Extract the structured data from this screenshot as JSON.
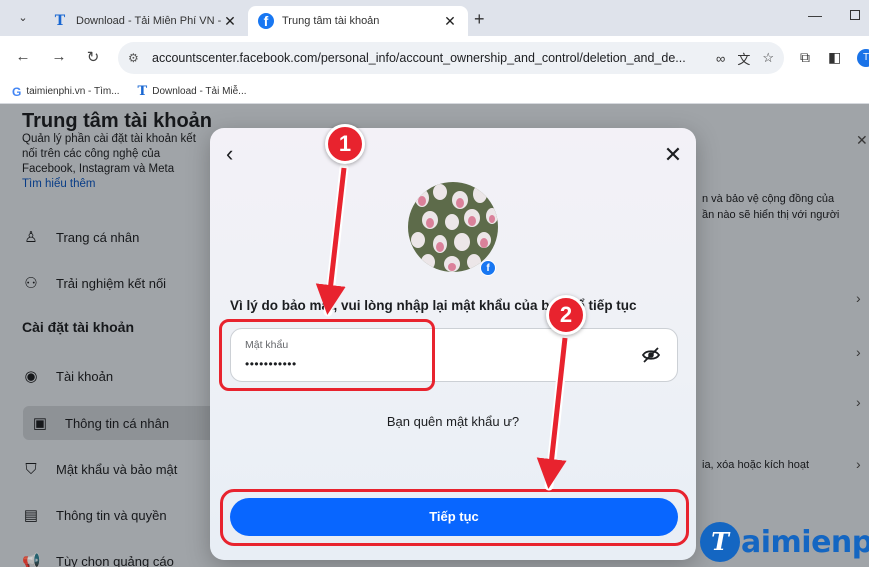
{
  "browser": {
    "tabs": [
      {
        "title": "Download - Tải Miễn Phí VN - P",
        "active": false,
        "icon": "taimienphi-favicon"
      },
      {
        "title": "Trung tâm tài khoản",
        "active": true,
        "icon": "facebook-favicon"
      }
    ],
    "url": "accountscenter.facebook.com/personal_info/account_ownership_and_control/deletion_and_de...",
    "bookmarks": [
      {
        "label": "taimienphi.vn - Tìm...",
        "icon": "google-favicon"
      },
      {
        "label": "Download - Tải Miễ...",
        "icon": "taimienphi-favicon"
      }
    ]
  },
  "background_page": {
    "title": "Trung tâm tài khoản",
    "description": "Quản lý phần cài đặt tài khoản kết nối trên các công nghệ của Facebook, Instagram và Meta",
    "learn_more": "Tìm hiểu thêm",
    "profile_items": [
      {
        "label": "Trang cá nhân",
        "icon": "person-icon"
      },
      {
        "label": "Trải nghiệm kết nối",
        "icon": "people-icon"
      }
    ],
    "settings_heading": "Cài đặt tài khoản",
    "settings_items": [
      {
        "label": "Tài khoản",
        "icon": "account-icon"
      },
      {
        "label": "Thông tin cá nhân",
        "icon": "id-card-icon",
        "selected": true
      },
      {
        "label": "Mật khẩu và bảo mật",
        "icon": "shield-icon"
      },
      {
        "label": "Thông tin và quyền",
        "icon": "document-icon"
      },
      {
        "label": "Tùy chọn quảng cáo",
        "icon": "megaphone-icon"
      }
    ],
    "right_texts": [
      "n và bảo vệ cộng đồng của",
      "ần nào sẽ hiển thị với người",
      "ia, xóa hoặc kích hoạt"
    ]
  },
  "modal": {
    "prompt": "Vì lý do bảo mật, vui lòng nhập lại mật khẩu của bạn để tiếp tục",
    "password_label": "Mật khẩu",
    "password_value": "•••••••••••",
    "forgot_link": "Bạn quên mật khẩu ư?",
    "submit_label": "Tiếp tục"
  },
  "annotations": {
    "step1": "1",
    "step2": "2",
    "highlight_color": "#e8232e"
  },
  "watermark": {
    "logo_letter": "T",
    "text": "aimienph"
  },
  "colors": {
    "facebook_blue": "#0866ff",
    "annotation_red": "#e8232e"
  }
}
